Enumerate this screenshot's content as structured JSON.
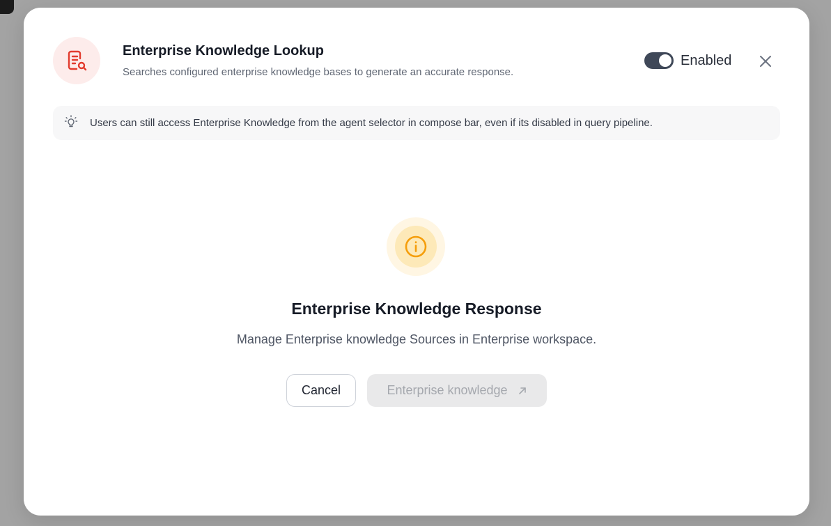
{
  "modal": {
    "title": "Enterprise Knowledge Lookup",
    "subtitle": "Searches configured enterprise knowledge bases to generate an accurate response.",
    "header_icon": "document-search-icon",
    "toggle": {
      "label": "Enabled",
      "state": true
    },
    "close_icon": "close-icon"
  },
  "notice": {
    "icon": "lightbulb-icon",
    "text": "Users can still access Enterprise Knowledge from the agent selector in compose bar, even if its disabled in query pipeline."
  },
  "empty_state": {
    "icon": "info-icon",
    "title": "Enterprise Knowledge Response",
    "description": "Manage Enterprise knowledge Sources in Enterprise workspace."
  },
  "actions": {
    "cancel_label": "Cancel",
    "primary_label": "Enterprise knowledge",
    "primary_icon": "external-arrow-icon",
    "primary_disabled": true
  },
  "colors": {
    "accent_red": "#e23b2e",
    "info_amber": "#f59e0b",
    "toggle_on": "#3f4858"
  }
}
